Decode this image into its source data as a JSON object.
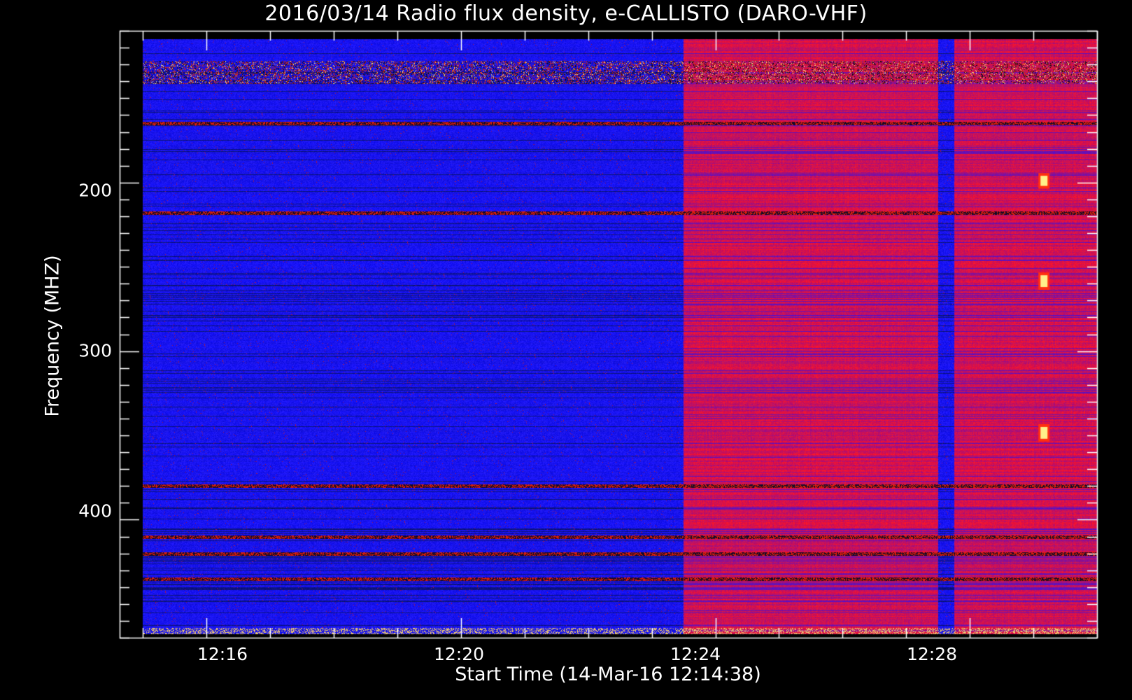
{
  "chart_data": {
    "type": "heatmap",
    "title": "2016/03/14  Radio flux density, e-CALLISTO (DARO-VHF)",
    "xlabel": "Start Time (14-Mar-16 12:14:38)",
    "ylabel": "Frequency (MHZ)",
    "x_unit": "time (hh:mm)",
    "xlim": [
      "12:14:38",
      "12:30:00"
    ],
    "ylim": [
      110,
      470
    ],
    "y_inverted": true,
    "x_ticks": [
      "12:16",
      "12:20",
      "12:24",
      "12:28"
    ],
    "y_ticks": [
      "200",
      "300",
      "400"
    ],
    "data_extent": {
      "t_start": "12:15:00",
      "t_end": "12:30:00",
      "f_start": 115,
      "f_end": 468
    },
    "colormap": [
      "#000000",
      "#1018ff",
      "#ff2000",
      "#ffff80"
    ],
    "regions": [
      {
        "label": "background",
        "t_start": "12:15:00",
        "t_end": "12:23:30",
        "level": "low"
      },
      {
        "label": "elevated flux",
        "t_start": "12:23:30",
        "t_end": "12:27:30",
        "level": "high"
      },
      {
        "label": "dip",
        "t_start": "12:27:30",
        "t_end": "12:27:45",
        "level": "low"
      },
      {
        "label": "elevated flux",
        "t_start": "12:27:45",
        "t_end": "12:30:00",
        "level": "high"
      }
    ],
    "bright_features": [
      {
        "t": "12:29:10",
        "f_range": [
          196,
          202
        ]
      },
      {
        "t": "12:29:10",
        "f_range": [
          255,
          262
        ]
      },
      {
        "t": "12:29:10",
        "f_range": [
          345,
          352
        ]
      }
    ],
    "horizontal_bands_mhz": [
      165,
      218,
      380,
      410,
      420,
      435
    ]
  }
}
